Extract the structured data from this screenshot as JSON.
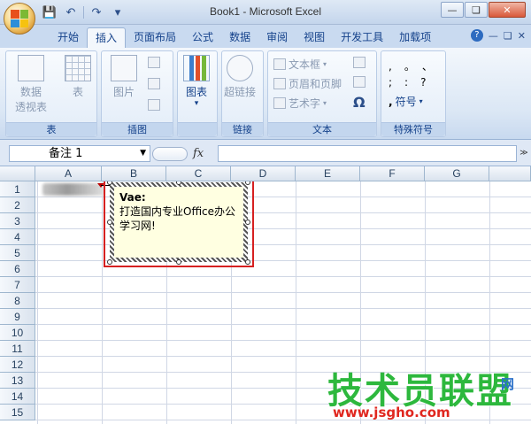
{
  "window": {
    "title": "Book1 - Microsoft Excel"
  },
  "quick_access": {
    "save_icon": "save-icon",
    "undo_icon": "undo-icon",
    "redo_icon": "redo-icon"
  },
  "ribbon_tabs": [
    "开始",
    "插入",
    "页面布局",
    "公式",
    "数据",
    "审阅",
    "视图",
    "开发工具",
    "加载项"
  ],
  "active_tab": "插入",
  "groups": {
    "table": {
      "label": "表",
      "buttons": [
        "数据",
        "透视表",
        "表"
      ]
    },
    "illustrations": {
      "label": "插图",
      "buttons": [
        "图片"
      ]
    },
    "charts": {
      "label": "",
      "buttons": [
        "图表"
      ]
    },
    "links": {
      "label": "链接",
      "buttons": [
        "超链接"
      ]
    },
    "text": {
      "label": "文本",
      "buttons": [
        "文本框",
        "页眉和页脚",
        "艺术字"
      ]
    },
    "symbols": {
      "label": "特殊符号",
      "buttons": [
        "符号"
      ]
    }
  },
  "formula_bar": {
    "name_box": "备注 1",
    "fx": "fx",
    "value": ""
  },
  "columns": [
    "A",
    "B",
    "C",
    "D",
    "E",
    "F",
    "G"
  ],
  "rows": [
    "1",
    "2",
    "3",
    "4",
    "5",
    "6",
    "7",
    "8",
    "9",
    "10",
    "11",
    "12",
    "13",
    "14",
    "15"
  ],
  "comment": {
    "author": "Vae:",
    "text": "打造国内专业Office办公学习网!"
  },
  "watermark": {
    "main": "技术员联盟",
    "url": "www.jsgho.com",
    "small": "网"
  }
}
